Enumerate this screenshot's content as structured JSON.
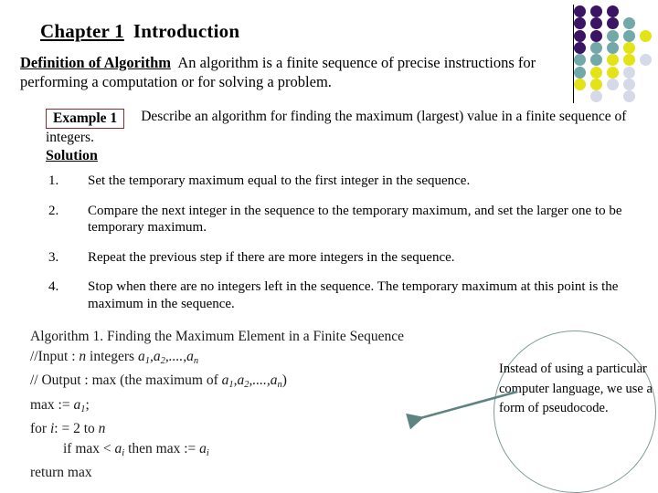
{
  "slide": {
    "title": {
      "chapter_label": "Chapter 1",
      "chapter_name": "Introduction"
    },
    "definition": {
      "lead": "Definition of Algorithm",
      "body": "An algorithm is a finite sequence of precise instructions for performing a computation or for solving a problem."
    },
    "example": {
      "badge": "Example 1",
      "prompt": "Describe an algorithm for finding the maximum (largest) value in a finite sequence of integers.",
      "solution_label": "Solution"
    },
    "steps": [
      {
        "num": "1.",
        "text": "Set the temporary maximum equal to the first integer in the sequence."
      },
      {
        "num": "2.",
        "text": "Compare the next integer in the sequence to the temporary maximum, and set the larger one to be temporary maximum."
      },
      {
        "num": "3.",
        "text": "Repeat the previous step if there are more integers in the sequence."
      },
      {
        "num": "4.",
        "text": "Stop when there are no integers left in the sequence. The temporary maximum at this point is the maximum in the sequence."
      }
    ],
    "pseudocode": {
      "heading": "Algorithm 1. Finding the Maximum Element in a Finite Sequence",
      "input_prefix": "//Input : ",
      "input_n": "n",
      "input_mid": " integers ",
      "input_seq": "a1,a2,....,an",
      "output_prefix": "// Output : max (the maximum of  ",
      "output_seq": "a1,a2,....,an",
      "output_suffix": ")",
      "line_assign": "max := a1;",
      "line_for": "for i: = 2 to n",
      "line_if": "if max < ai then max := ai",
      "line_return": "return max"
    },
    "callout": {
      "text": "Instead of using a particular computer language, we use a form of pseudocode.",
      "circle_color": "#7f9a9a",
      "arrow_color": "#5f8383"
    },
    "decor": {
      "dot_colors": {
        "purple": "#3b1464",
        "teal": "#73a8a8",
        "yellow": "#e3e317",
        "lavender": "#d6d9e8"
      },
      "dot_grid": [
        [
          "purple",
          "purple",
          "purple",
          null,
          null
        ],
        [
          "purple",
          "purple",
          "purple",
          "teal",
          null
        ],
        [
          "purple",
          "purple",
          "teal",
          "teal",
          "yellow"
        ],
        [
          "purple",
          "teal",
          "teal",
          "yellow",
          null
        ],
        [
          "teal",
          "teal",
          "yellow",
          "yellow",
          "lavender"
        ],
        [
          "teal",
          "yellow",
          "yellow",
          "lavender",
          null
        ],
        [
          "yellow",
          "yellow",
          "lavender",
          "lavender",
          null
        ],
        [
          null,
          "lavender",
          null,
          "lavender",
          null
        ]
      ]
    },
    "accent_colors": {
      "example_border": "#8d2b2b",
      "rule": "#000000"
    }
  }
}
